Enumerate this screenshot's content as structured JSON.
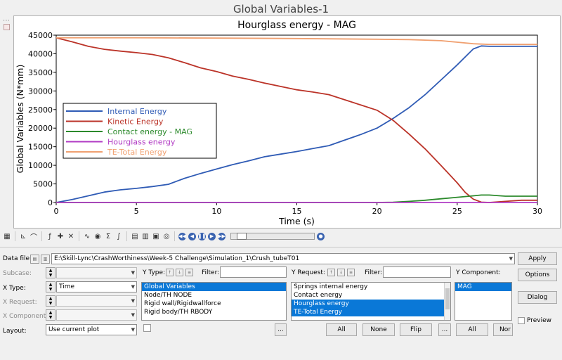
{
  "window": {
    "title": "Global Variables-1"
  },
  "chart_data": {
    "type": "line",
    "title": "Hourglass energy - MAG",
    "xlabel": "Time (s)",
    "ylabel": "Global Variables (N*mm)",
    "xlim": [
      0,
      30
    ],
    "ylim": [
      0,
      45000
    ],
    "xticks": [
      0,
      5,
      10,
      15,
      20,
      25,
      30
    ],
    "yticks": [
      0,
      5000,
      10000,
      15000,
      20000,
      25000,
      30000,
      35000,
      40000,
      45000
    ],
    "grid": true,
    "legend": "upper-left",
    "series": [
      {
        "name": "Internal Energy",
        "color": "#2f5bb5",
        "x": [
          0,
          1,
          2,
          3,
          4,
          5,
          6,
          7,
          8,
          9,
          10,
          11,
          12,
          13,
          14,
          15,
          16,
          17,
          18,
          19,
          20,
          21,
          22,
          23,
          24,
          25,
          26,
          26.5,
          27,
          28,
          29,
          30
        ],
        "y": [
          0,
          800,
          1800,
          2800,
          3400,
          3800,
          4300,
          4900,
          6500,
          7800,
          9000,
          10200,
          11200,
          12300,
          13000,
          13700,
          14500,
          15300,
          16800,
          18300,
          20000,
          22600,
          25500,
          29000,
          33000,
          37000,
          41300,
          42100,
          42000,
          42000,
          42000,
          42000
        ]
      },
      {
        "name": "Kinetic Energy",
        "color": "#bb3328",
        "x": [
          0,
          1,
          2,
          3,
          4,
          5,
          6,
          7,
          8,
          9,
          10,
          11,
          12,
          13,
          14,
          15,
          16,
          17,
          18,
          19,
          20,
          21,
          22,
          23,
          24,
          25,
          25.5,
          26,
          26.5,
          27,
          28,
          29,
          30
        ],
        "y": [
          44300,
          43200,
          42000,
          41200,
          40700,
          40300,
          39800,
          38900,
          37600,
          36200,
          35200,
          34000,
          33100,
          32100,
          31200,
          30300,
          29700,
          29000,
          27600,
          26200,
          24800,
          22100,
          18400,
          14400,
          9900,
          5300,
          2700,
          900,
          100,
          0,
          300,
          600,
          600
        ]
      },
      {
        "name": "Contact energy - MAG",
        "color": "#2c8a2c",
        "x": [
          0,
          20,
          21,
          22,
          23,
          24,
          25,
          26,
          26.5,
          27,
          28,
          29,
          30
        ],
        "y": [
          0,
          0,
          50,
          300,
          600,
          1000,
          1400,
          1800,
          2000,
          2000,
          1700,
          1700,
          1700
        ]
      },
      {
        "name": "Hourglass energy",
        "color": "#b13bc4",
        "x": [
          0,
          10,
          20,
          30
        ],
        "y": [
          0,
          0,
          0,
          0
        ]
      },
      {
        "name": "TE-Total Energy",
        "color": "#f0a070",
        "x": [
          0,
          5,
          10,
          15,
          20,
          22,
          24,
          25,
          26,
          27,
          28,
          29,
          30
        ],
        "y": [
          44300,
          44300,
          44200,
          44100,
          43900,
          43800,
          43500,
          43100,
          42700,
          42500,
          42500,
          42500,
          42500
        ]
      }
    ]
  },
  "toolbar": {
    "icons": [
      "plot-type-icon",
      "axis-icon",
      "curve-icon",
      "math-icon",
      "color-icon",
      "sigma-icon",
      "integrate-icon",
      "grid-icon",
      "notes-icon",
      "camera-icon",
      "rewind-icon",
      "prev-icon",
      "play-icon",
      "next-icon",
      "end-icon"
    ]
  },
  "form": {
    "data_file_label": "Data file:",
    "data_file_value": "E:\\Skill-Lync\\CrashWorthiness\\Week-5 Challenge\\Simulation_1\\Crush_tubeT01",
    "apply_label": "Apply",
    "options_label": "Options",
    "dialog_label": "Dialog",
    "preview_label": "Preview",
    "subcase_label": "Subcase:",
    "xtype_label": "X Type:",
    "xtype_value": "Time",
    "xrequest_label": "X Request:",
    "xcomponent_label": "X Component:",
    "layout_label": "Layout:",
    "layout_value": "Use current plot",
    "ytype_label": "Y Type:",
    "filter_label": "Filter:",
    "yrequest_label": "Y Request:",
    "ycomponent_label": "Y Component:",
    "ytype_items": [
      "Global Variables",
      "Node/TH NODE",
      "Rigid wall/Rigidwallforce",
      "Rigid body/TH RBODY"
    ],
    "yrequest_items": [
      "Springs internal energy",
      "Contact energy",
      "Hourglass energy",
      "TE-Total Energy"
    ],
    "ycomponent_items": [
      "MAG"
    ],
    "ellipsis": "...",
    "all_label": "All",
    "none_label": "None",
    "flip_label": "Flip",
    "none_truncated": "Nor"
  }
}
